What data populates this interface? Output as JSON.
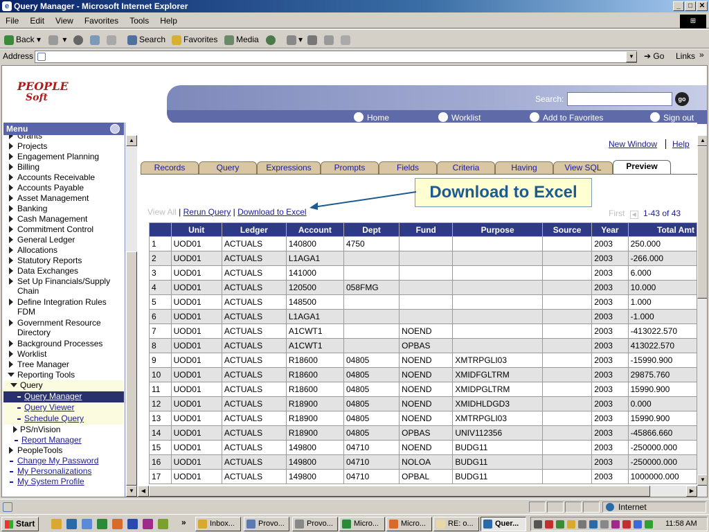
{
  "window": {
    "title": "Query Manager - Microsoft Internet Explorer",
    "minimize": "_",
    "maximize": "□",
    "close": "✕"
  },
  "menubar": [
    "File",
    "Edit",
    "View",
    "Favorites",
    "Tools",
    "Help"
  ],
  "toolbar": {
    "back": "Back",
    "search": "Search",
    "favorites": "Favorites",
    "media": "Media"
  },
  "address": {
    "label": "Address",
    "value": "",
    "go": "Go",
    "links": "Links"
  },
  "ps": {
    "logo_top": "PEOPLE",
    "logo_bottom": "Soft",
    "search_label": "Search:",
    "go": "go",
    "home": "Home",
    "worklist": "Worklist",
    "add_favorites": "Add to Favorites",
    "signout": "Sign out"
  },
  "menu": {
    "title": "Menu",
    "items": [
      {
        "label": "Grants"
      },
      {
        "label": "Projects"
      },
      {
        "label": "Engagement Planning"
      },
      {
        "label": "Billing"
      },
      {
        "label": "Accounts Receivable"
      },
      {
        "label": "Accounts Payable"
      },
      {
        "label": "Asset Management"
      },
      {
        "label": "Banking"
      },
      {
        "label": "Cash Management"
      },
      {
        "label": "Commitment Control"
      },
      {
        "label": "General Ledger"
      },
      {
        "label": "Allocations"
      },
      {
        "label": "Statutory Reports"
      },
      {
        "label": "Data Exchanges"
      },
      {
        "label": "Set Up Financials/Supply",
        "label2": "Chain"
      },
      {
        "label": "Define Integration Rules",
        "label2": "FDM"
      },
      {
        "label": "Government Resource",
        "label2": "Directory"
      },
      {
        "label": "Background Processes"
      },
      {
        "label": "Worklist"
      },
      {
        "label": "Tree Manager"
      },
      {
        "label": "Reporting Tools"
      },
      {
        "label": "Query"
      },
      {
        "label": "Query Manager"
      },
      {
        "label": "Query Viewer"
      },
      {
        "label": "Schedule Query"
      },
      {
        "label": "PS/nVision"
      },
      {
        "label": "Report Manager"
      },
      {
        "label": "PeopleTools"
      },
      {
        "label": "Change My Password"
      },
      {
        "label": "My Personalizations"
      },
      {
        "label": "My System Profile"
      }
    ]
  },
  "content": {
    "new_window": "New Window",
    "help": "Help",
    "tabs": [
      "Records",
      "Query",
      "Expressions",
      "Prompts",
      "Fields",
      "Criteria",
      "Having",
      "View SQL",
      "Preview"
    ],
    "active_tab": "Preview",
    "callout": "Download to Excel",
    "view_all": "View All",
    "sep": "|",
    "rerun": "Rerun Query",
    "download": "Download to Excel",
    "first": "First",
    "range": "1-43 of 43"
  },
  "table": {
    "columns": [
      "",
      "Unit",
      "Ledger",
      "Account",
      "Dept",
      "Fund",
      "Purpose",
      "Source",
      "Year",
      "Total Amt"
    ],
    "rows": [
      [
        "1",
        "UOD01",
        "ACTUALS",
        "140800",
        "4750",
        "",
        "",
        "",
        "2003",
        "250.000"
      ],
      [
        "2",
        "UOD01",
        "ACTUALS",
        "L1AGA1",
        "",
        "",
        "",
        "",
        "2003",
        "-266.000"
      ],
      [
        "3",
        "UOD01",
        "ACTUALS",
        "141000",
        "",
        "",
        "",
        "",
        "2003",
        "6.000"
      ],
      [
        "4",
        "UOD01",
        "ACTUALS",
        "120500",
        "058FMG",
        "",
        "",
        "",
        "2003",
        "10.000"
      ],
      [
        "5",
        "UOD01",
        "ACTUALS",
        "148500",
        "",
        "",
        "",
        "",
        "2003",
        "1.000"
      ],
      [
        "6",
        "UOD01",
        "ACTUALS",
        "L1AGA1",
        "",
        "",
        "",
        "",
        "2003",
        "-1.000"
      ],
      [
        "7",
        "UOD01",
        "ACTUALS",
        "A1CWT1",
        "",
        "NOEND",
        "",
        "",
        "2003",
        "-413022.570"
      ],
      [
        "8",
        "UOD01",
        "ACTUALS",
        "A1CWT1",
        "",
        "OPBAS",
        "",
        "",
        "2003",
        "413022.570"
      ],
      [
        "9",
        "UOD01",
        "ACTUALS",
        "R18600",
        "04805",
        "NOEND",
        "XMTRPGLI03",
        "",
        "2003",
        "-15990.900"
      ],
      [
        "10",
        "UOD01",
        "ACTUALS",
        "R18600",
        "04805",
        "NOEND",
        "XMIDFGLTRM",
        "",
        "2003",
        "29875.760"
      ],
      [
        "11",
        "UOD01",
        "ACTUALS",
        "R18600",
        "04805",
        "NOEND",
        "XMIDPGLTRM",
        "",
        "2003",
        "15990.900"
      ],
      [
        "12",
        "UOD01",
        "ACTUALS",
        "R18900",
        "04805",
        "NOEND",
        "XMIDHLDGD3",
        "",
        "2003",
        "0.000"
      ],
      [
        "13",
        "UOD01",
        "ACTUALS",
        "R18900",
        "04805",
        "NOEND",
        "XMTRPGLI03",
        "",
        "2003",
        "15990.900"
      ],
      [
        "14",
        "UOD01",
        "ACTUALS",
        "R18900",
        "04805",
        "OPBAS",
        "UNIV112356",
        "",
        "2003",
        "-45866.660"
      ],
      [
        "15",
        "UOD01",
        "ACTUALS",
        "149800",
        "04710",
        "NOEND",
        "BUDG11",
        "",
        "2003",
        "-250000.000"
      ],
      [
        "16",
        "UOD01",
        "ACTUALS",
        "149800",
        "04710",
        "NOLOA",
        "BUDG11",
        "",
        "2003",
        "-250000.000"
      ],
      [
        "17",
        "UOD01",
        "ACTUALS",
        "149800",
        "04710",
        "OPBAL",
        "BUDG11",
        "",
        "2003",
        "1000000.000"
      ]
    ]
  },
  "status": {
    "zone": "Internet"
  },
  "taskbar": {
    "start": "Start",
    "more": "»",
    "tasks": [
      "Inbox...",
      "Provo...",
      "Provo...",
      "Micro...",
      "Micro...",
      "RE: o...",
      "Quer..."
    ],
    "clock": "11:58 AM"
  }
}
